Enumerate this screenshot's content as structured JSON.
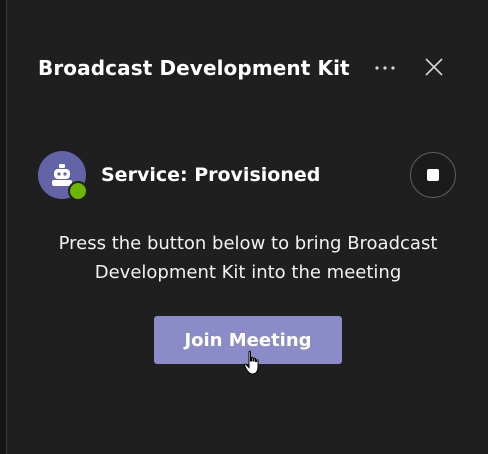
{
  "header": {
    "title": "Broadcast Development Kit",
    "more_icon": "more-horizontal-icon",
    "close_icon": "close-icon"
  },
  "service": {
    "status_text": "Service: Provisioned",
    "avatar_icon": "bot-icon",
    "presence_status": "available",
    "stop_icon": "stop-icon"
  },
  "body": {
    "description": "Press the button below to bring Broadcast Development Kit into the meeting"
  },
  "actions": {
    "join_label": "Join Meeting"
  },
  "colors": {
    "background": "#1f1f1f",
    "accent": "#8b8cc7",
    "avatar": "#6264a7",
    "presence": "#6bb700"
  }
}
